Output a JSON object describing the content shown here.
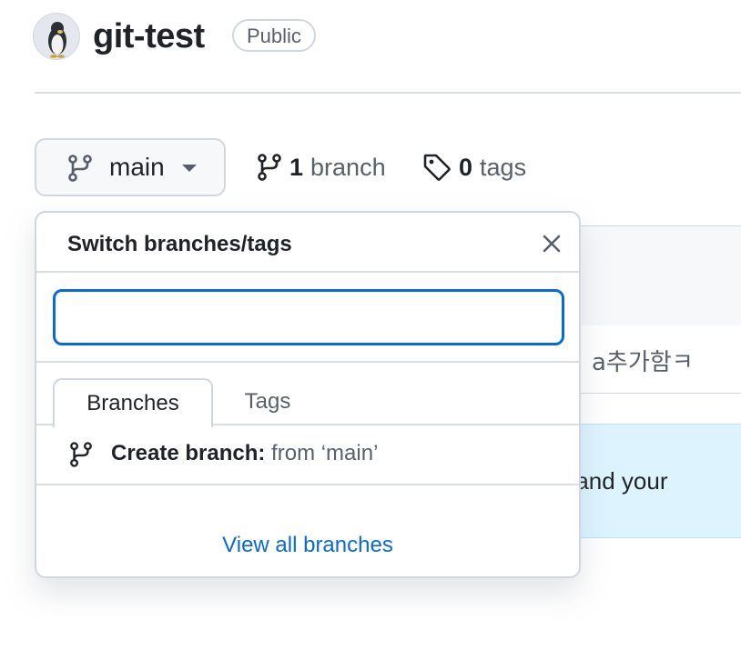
{
  "repo": {
    "name": "git-test",
    "visibility": "Public"
  },
  "branch_bar": {
    "current_branch": "main",
    "branch_count": "1",
    "branch_label": "branch",
    "tag_count": "0",
    "tag_label": "tags"
  },
  "background": {
    "commit_message": "a추가함ㅋ",
    "readme_banner_text": "Add a README with an overview of your project to help people understand your"
  },
  "dropdown": {
    "title": "Switch branches/tags",
    "filter_value": "",
    "filter_placeholder": "",
    "tabs": [
      {
        "label": "Branches",
        "active": true
      },
      {
        "label": "Tags",
        "active": false
      }
    ],
    "create_label": "Create branch:",
    "create_from": " from ‘main’",
    "view_all": "View all branches"
  },
  "colors": {
    "accent": "#0969da",
    "border": "#d0d7de",
    "muted": "#57606a",
    "readme_bg": "#ddf4ff"
  },
  "icons": [
    "avatar-penguin",
    "git-branch-icon",
    "tag-icon",
    "close-icon",
    "caret-down-icon"
  ]
}
